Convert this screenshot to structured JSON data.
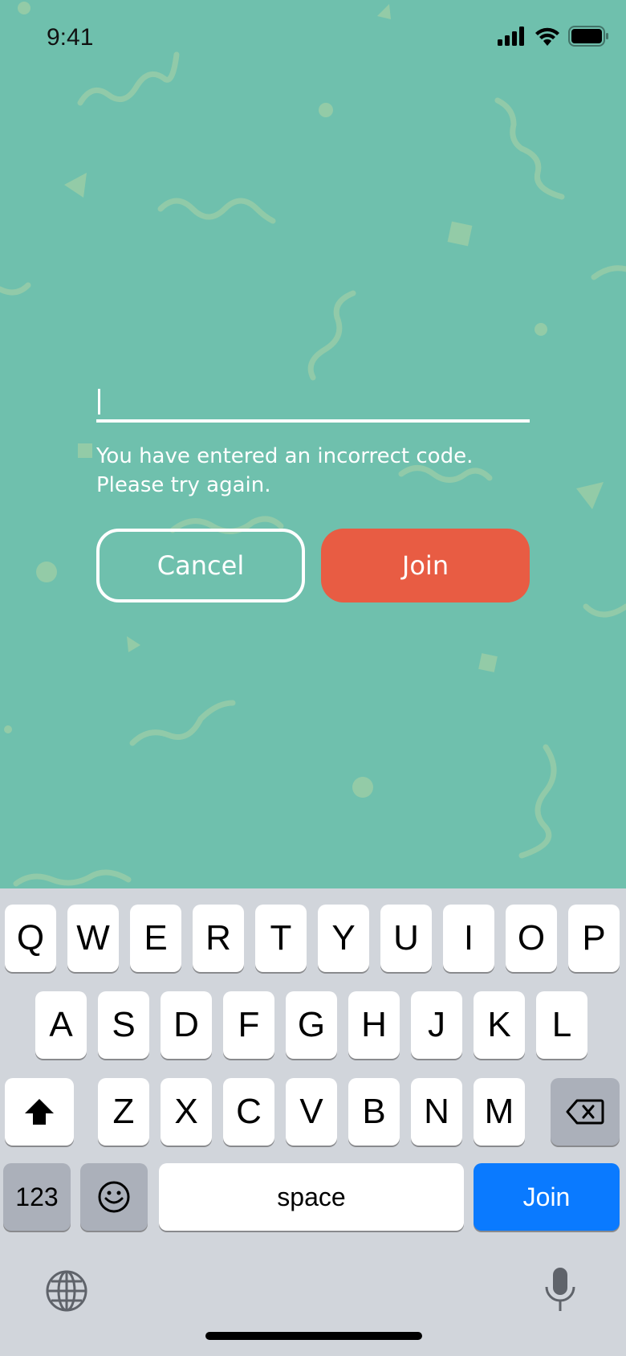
{
  "status_bar": {
    "time": "9:41"
  },
  "code_input": {
    "value": "",
    "placeholder": ""
  },
  "error": {
    "line1": "You have entered an incorrect code.",
    "line2": "Please try again."
  },
  "buttons": {
    "cancel": "Cancel",
    "join": "Join"
  },
  "keyboard": {
    "row1": [
      "Q",
      "W",
      "E",
      "R",
      "T",
      "Y",
      "U",
      "I",
      "O",
      "P"
    ],
    "row2": [
      "A",
      "S",
      "D",
      "F",
      "G",
      "H",
      "J",
      "K",
      "L"
    ],
    "row3": [
      "Z",
      "X",
      "C",
      "V",
      "B",
      "N",
      "M"
    ],
    "numbers_key": "123",
    "space_key": "space",
    "return_key": "Join"
  },
  "colors": {
    "background": "#6fc0ad",
    "join_button": "#e85c43",
    "keyboard_return": "#0a7aff"
  }
}
